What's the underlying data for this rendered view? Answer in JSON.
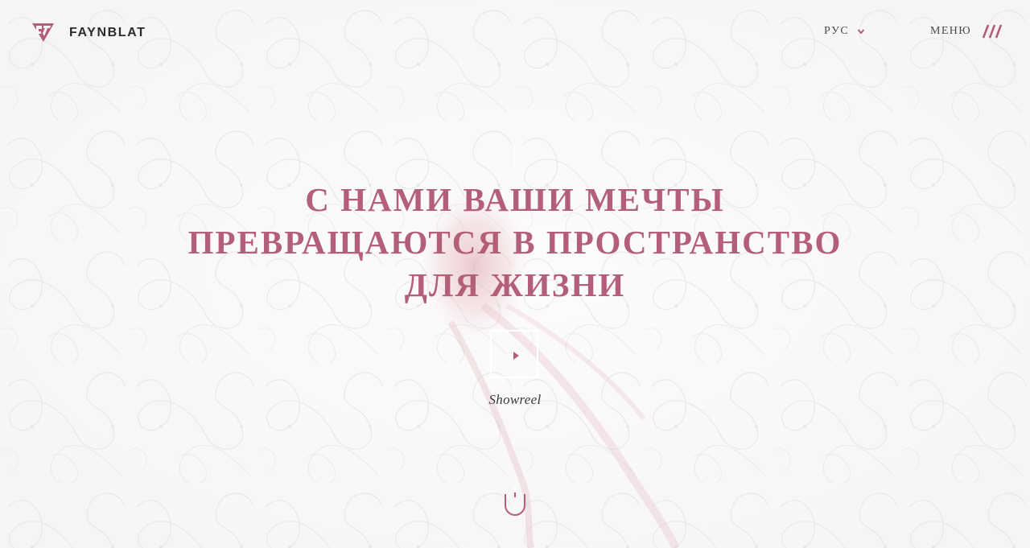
{
  "brand": {
    "name": "FAYNBLAT",
    "accent": "#b35f7a"
  },
  "header": {
    "language": "РУС",
    "menu_label": "МЕНЮ"
  },
  "hero": {
    "lines": [
      "С НАМИ ВАШИ МЕЧТЫ",
      "ПРЕВРАЩАЮТСЯ В ПРОСТРАНСТВО",
      "ДЛЯ ЖИЗНИ"
    ],
    "showreel_label": "Showreel"
  },
  "icons": {
    "logo": "faynblat-logo-icon",
    "language_dropdown": "chevron-down-icon",
    "menu": "hamburger-slashes-icon",
    "play": "play-icon",
    "scroll": "scroll-down-icon"
  }
}
